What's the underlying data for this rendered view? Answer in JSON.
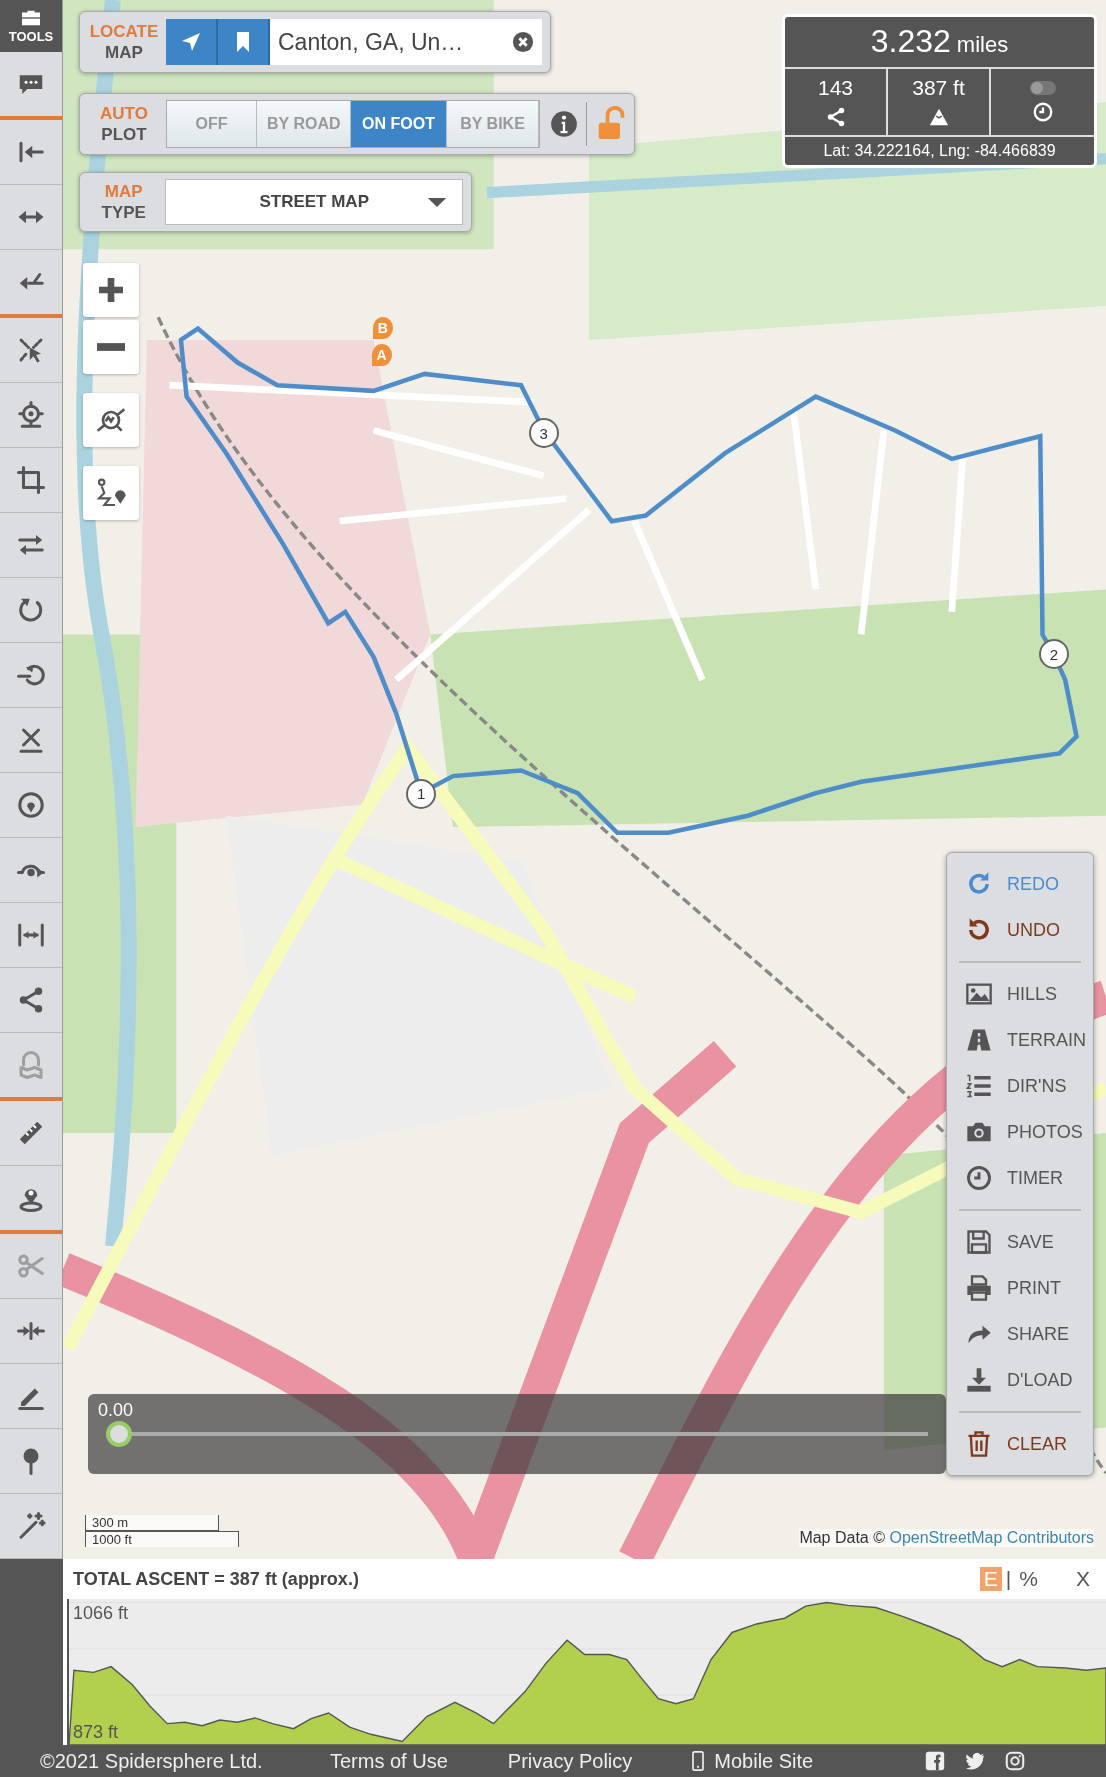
{
  "tools": {
    "title": "TOOLS",
    "items": [
      {
        "disabled": false
      },
      {
        "disabled": false
      },
      {
        "disabled": false
      },
      {
        "disabled": false
      },
      {
        "disabled": false
      },
      {
        "disabled": false
      },
      {
        "disabled": false
      },
      {
        "disabled": false
      },
      {
        "disabled": false
      },
      {
        "disabled": false
      },
      {
        "disabled": false
      },
      {
        "disabled": false
      },
      {
        "disabled": false
      },
      {
        "disabled": false
      },
      {
        "disabled": false
      },
      {
        "disabled": true
      },
      {
        "disabled": false
      },
      {
        "disabled": false
      },
      {
        "disabled": true
      },
      {
        "disabled": false
      },
      {
        "disabled": false
      },
      {
        "disabled": false
      },
      {
        "disabled": false
      }
    ]
  },
  "locate": {
    "label_top": "LOCATE",
    "label_bottom": "MAP",
    "value": "Canton, GA, Un…"
  },
  "auto_plot": {
    "label_top": "AUTO",
    "label_bottom": "PLOT",
    "locked": false,
    "options": [
      {
        "label": "OFF",
        "selected": false
      },
      {
        "label": "BY ROAD",
        "selected": false
      },
      {
        "label": "ON FOOT",
        "selected": true
      },
      {
        "label": "BY BIKE",
        "selected": false
      }
    ]
  },
  "map_type": {
    "label_top": "MAP",
    "label_bottom": "TYPE",
    "value": "STREET MAP"
  },
  "stats": {
    "distance": "3.232",
    "unit": "miles",
    "points": "143",
    "ascent": "387 ft",
    "timer_on": false,
    "coords": "Lat: 34.222164, Lng: -84.466839"
  },
  "route": {
    "markers": [
      "B",
      "A"
    ],
    "waypoints": [
      "1",
      "2",
      "3"
    ]
  },
  "menu": {
    "groups": [
      {
        "items": [
          {
            "label": "REDO",
            "color": "#4a8ccf"
          },
          {
            "label": "UNDO",
            "color": "#7d3a1e"
          }
        ]
      },
      {
        "items": [
          {
            "label": "HILLS",
            "color": "#555555"
          },
          {
            "label": "TERRAIN",
            "color": "#555555"
          },
          {
            "label": "DIR'NS",
            "color": "#555555"
          },
          {
            "label": "PHOTOS",
            "color": "#555555"
          },
          {
            "label": "TIMER",
            "color": "#555555"
          }
        ]
      },
      {
        "items": [
          {
            "label": "SAVE",
            "color": "#555555"
          },
          {
            "label": "PRINT",
            "color": "#555555"
          },
          {
            "label": "SHARE",
            "color": "#555555"
          },
          {
            "label": "D'LOAD",
            "color": "#555555"
          }
        ]
      },
      {
        "items": [
          {
            "label": "CLEAR",
            "color": "#7d3a1e"
          }
        ]
      }
    ]
  },
  "playback": {
    "reading": "0.00",
    "level": 0
  },
  "scale": {
    "metric": "300 m",
    "imperial": "1000 ft"
  },
  "attribution": {
    "text": "Map Data ©",
    "link": "OpenStreetMap Contributors"
  },
  "elevation": {
    "title": "TOTAL ASCENT = 387 ft (approx.)",
    "modes": [
      {
        "label": "E",
        "selected": true
      },
      {
        "label": "%",
        "selected": false
      }
    ],
    "separator": "|",
    "close": "X",
    "max": "1066 ft",
    "min": "873 ft"
  },
  "footer": {
    "copyright": "©2021 Spidersphere Ltd.",
    "links": [
      "Terms of Use",
      "Privacy Policy"
    ],
    "mobile": "Mobile Site"
  }
}
